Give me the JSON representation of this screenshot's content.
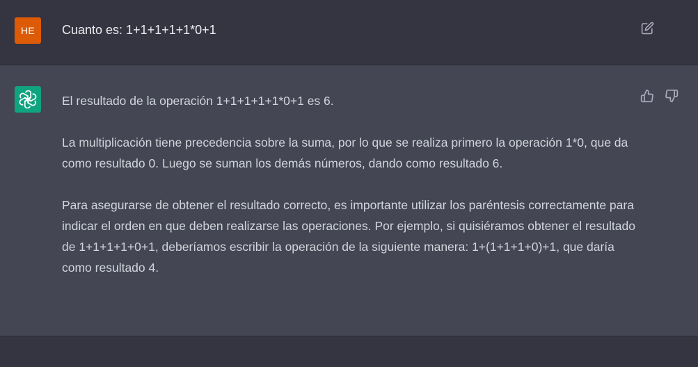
{
  "colors": {
    "user_avatar_bg": "#dd5a06",
    "assistant_avatar_bg": "#10a37f",
    "user_row_bg": "#343541",
    "assistant_row_bg": "#444654"
  },
  "user_message": {
    "avatar_initials": "HE",
    "text": "Cuanto es: 1+1+1+1+1*0+1",
    "edit_icon": "edit-icon"
  },
  "assistant_message": {
    "avatar_icon": "openai-logo-icon",
    "paragraphs": [
      "El resultado de la operación 1+1+1+1+1*0+1 es 6.",
      "La multiplicación tiene precedencia sobre la suma, por lo que se realiza primero la operación 1*0, que da como resultado 0. Luego se suman los demás números, dando como resultado 6.",
      "Para asegurarse de obtener el resultado correcto, es importante utilizar los paréntesis correctamente para indicar el orden en que deben realizarse las operaciones. Por ejemplo, si quisiéramos obtener el resultado de 1+1+1+1+0+1, deberíamos escribir la operación de la siguiente manera: 1+(1+1+1+0)+1, que daría como resultado 4."
    ],
    "feedback_icons": [
      "thumbs-up-icon",
      "thumbs-down-icon"
    ]
  }
}
